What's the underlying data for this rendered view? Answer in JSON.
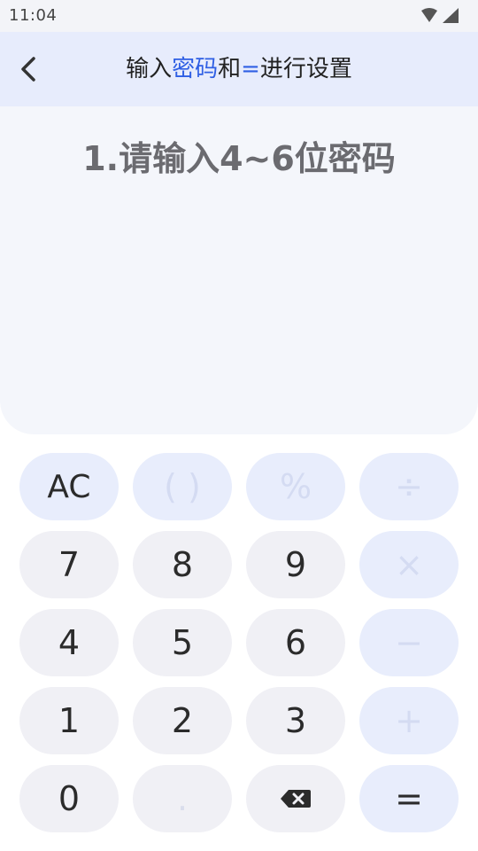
{
  "status_bar": {
    "time": "11:04"
  },
  "header": {
    "title_part1": "输入",
    "title_part2": "密码",
    "title_part3": "和",
    "title_part4": "=",
    "title_part5": "进行设置"
  },
  "display": {
    "prompt": "1.请输入4~6位密码"
  },
  "keypad": {
    "ac": "AC",
    "parens": "( )",
    "percent": "%",
    "divide": "÷",
    "seven": "7",
    "eight": "8",
    "nine": "9",
    "multiply": "×",
    "four": "4",
    "five": "5",
    "six": "6",
    "minus": "−",
    "one": "1",
    "two": "2",
    "three": "3",
    "plus": "+",
    "zero": "0",
    "dot": ".",
    "equals": "="
  },
  "colors": {
    "accent": "#2f5fe4",
    "header_bg": "#e7ecfc",
    "display_bg": "#f4f6fb",
    "num_key_bg": "#f0f0f5",
    "op_key_bg": "#e8edfc"
  }
}
